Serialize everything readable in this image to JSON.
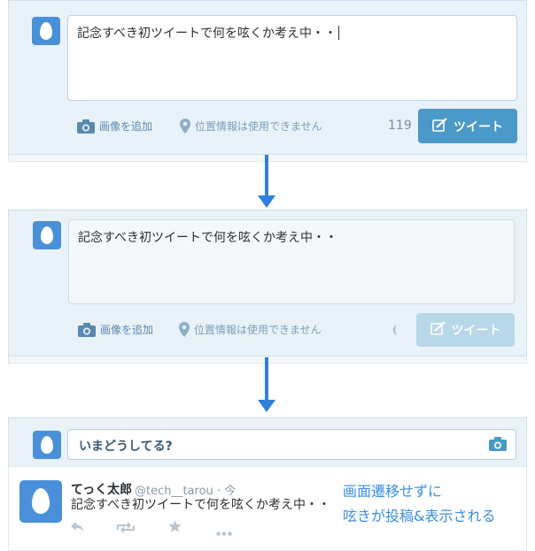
{
  "step1": {
    "tweet_text": "記念すべき初ツイートで何を呟くか考え中・・",
    "add_image_label": "画像を追加",
    "location_label": "位置情報は使用できません",
    "char_count": "119",
    "tweet_button_label": "ツイート"
  },
  "step2": {
    "tweet_text": "記念すべき初ツイートで何を呟くか考え中・・",
    "add_image_label": "画像を追加",
    "location_label": "位置情報は使用できません",
    "tweet_button_label": "ツイート"
  },
  "step3": {
    "compose_placeholder": "いまどうしてる?",
    "tweet": {
      "author_name": "てっく太郎",
      "handle": "@tech__tarou",
      "time": "· 今",
      "text": "記念すべき初ツイートで何を呟くか考え中・・"
    },
    "note_line1": "画面遷移せずに",
    "note_line2": "呟きが投稿&表示される"
  },
  "colors": {
    "accent": "#4a99c8",
    "arrow": "#2f7fdc",
    "note": "#3a8de0",
    "panel": "#e8f2f8"
  },
  "icons": [
    "egg-avatar-icon",
    "camera-icon",
    "location-pin-icon",
    "compose-quill-icon",
    "reply-icon",
    "retweet-icon",
    "favorite-star-icon",
    "more-icon",
    "down-arrow-icon"
  ]
}
